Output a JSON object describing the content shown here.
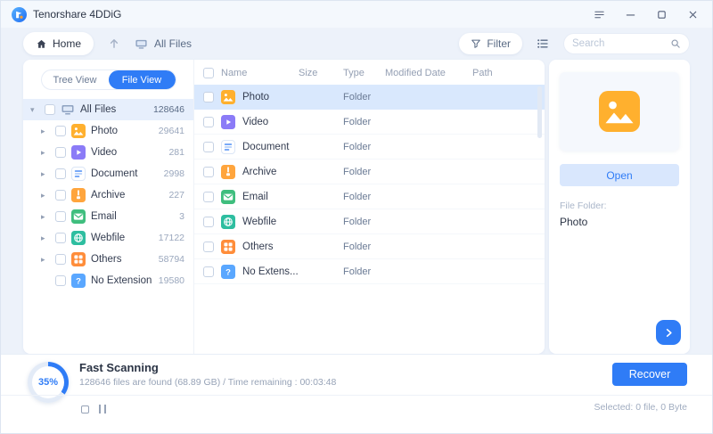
{
  "titlebar": {
    "app_name": "Tenorshare 4DDiG"
  },
  "navbar": {
    "home": "Home",
    "breadcrumb": "All Files",
    "filter": "Filter",
    "search_placeholder": "Search"
  },
  "sidebar": {
    "tabs": {
      "tree": "Tree View",
      "file": "File View"
    },
    "root": {
      "label": "All Files",
      "count": "128646",
      "icon": "drive"
    },
    "items": [
      {
        "label": "Photo",
        "count": "29641",
        "icon": "photo"
      },
      {
        "label": "Video",
        "count": "281",
        "icon": "video"
      },
      {
        "label": "Document",
        "count": "2998",
        "icon": "document"
      },
      {
        "label": "Archive",
        "count": "227",
        "icon": "archive"
      },
      {
        "label": "Email",
        "count": "3",
        "icon": "email"
      },
      {
        "label": "Webfile",
        "count": "17122",
        "icon": "webfile"
      },
      {
        "label": "Others",
        "count": "58794",
        "icon": "others"
      },
      {
        "label": "No Extension",
        "count": "19580",
        "icon": "noext"
      }
    ]
  },
  "table": {
    "columns": [
      "Name",
      "Size",
      "Type",
      "Modified Date",
      "Path"
    ],
    "rows": [
      {
        "name": "Photo",
        "type": "Folder",
        "icon": "photo"
      },
      {
        "name": "Video",
        "type": "Folder",
        "icon": "video"
      },
      {
        "name": "Document",
        "type": "Folder",
        "icon": "document"
      },
      {
        "name": "Archive",
        "type": "Folder",
        "icon": "archive"
      },
      {
        "name": "Email",
        "type": "Folder",
        "icon": "email"
      },
      {
        "name": "Webfile",
        "type": "Folder",
        "icon": "webfile"
      },
      {
        "name": "Others",
        "type": "Folder",
        "icon": "others"
      },
      {
        "name": "No Extens...",
        "type": "Folder",
        "icon": "noext"
      }
    ]
  },
  "preview": {
    "icon": "photo",
    "open": "Open",
    "file_folder_label": "File Folder:",
    "file_name": "Photo"
  },
  "status": {
    "percent": "35%",
    "title": "Fast Scanning",
    "detail": "128646 files are found (68.89 GB) /  Time remaining : 00:03:48",
    "recover": "Recover",
    "selected": "Selected: 0 file, 0 Byte"
  },
  "colors": {
    "accent": "#2F7CF6",
    "selected_row": "#d9e8fd",
    "photo": "#FFB02E",
    "video": "#8B7BF7",
    "document": "#4D8DF6",
    "archive": "#FFA53D",
    "email": "#3FBE7E",
    "webfile": "#2EBEA0",
    "others": "#FF8D3A",
    "no_extension": "#5AA7FF"
  }
}
